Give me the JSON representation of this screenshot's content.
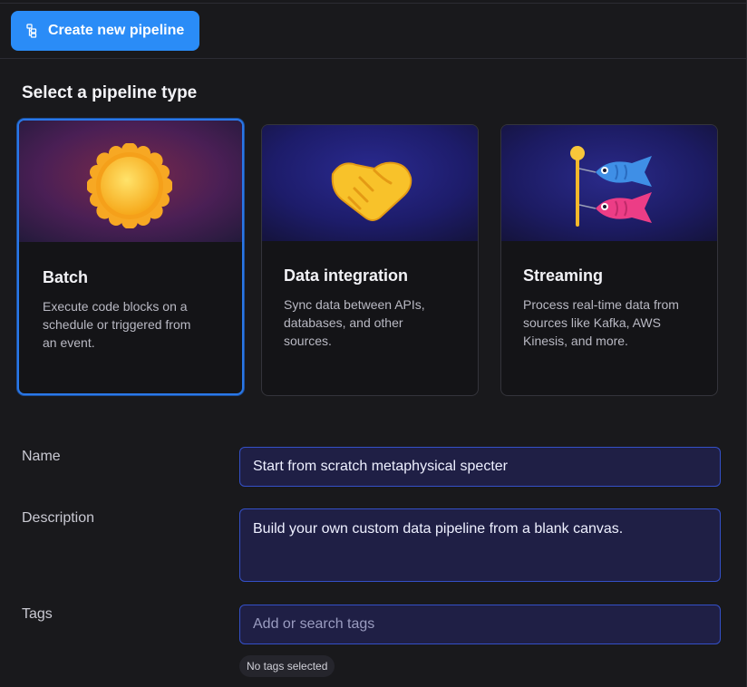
{
  "header": {
    "create_button_label": "Create new pipeline",
    "create_button_icon": "pipeline-blocks-icon"
  },
  "section_title": "Select a pipeline type",
  "pipeline_types": [
    {
      "title": "Batch",
      "description_lines": [
        "Execute code blocks on a",
        "schedule or triggered from",
        "an event."
      ],
      "icon": "sun-icon",
      "selected": true
    },
    {
      "title": "Data integration",
      "description_lines": [
        "Sync data between APIs,",
        "databases, and other",
        "sources."
      ],
      "icon": "handshake-icon",
      "selected": false
    },
    {
      "title": "Streaming",
      "description_lines": [
        "Process real-time data from",
        "sources like Kafka, AWS",
        "Kinesis, and more."
      ],
      "icon": "carp-streamer-icon",
      "selected": false
    }
  ],
  "form": {
    "name_label": "Name",
    "name_value": "Start from scratch metaphysical specter",
    "description_label": "Description",
    "description_value": "Build your own custom data pipeline from a blank canvas.",
    "tags_label": "Tags",
    "tags_placeholder": "Add or search tags",
    "tags_empty_text": "No tags selected"
  },
  "colors": {
    "accent": "#2a8cf7",
    "selected_border": "#2a78e8",
    "field_background": "#1f1f45",
    "field_border": "#3450c8"
  }
}
